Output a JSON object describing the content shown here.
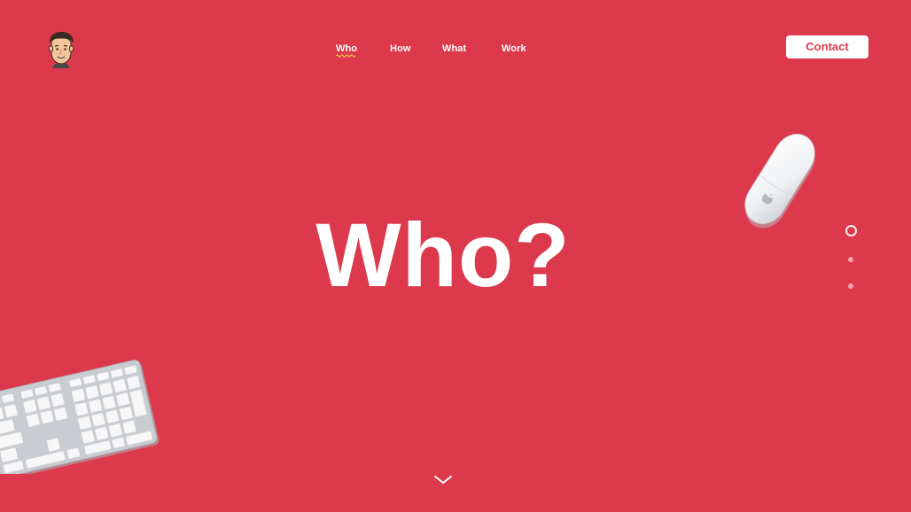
{
  "header": {
    "avatar_icon": "cartoon-face-avatar",
    "nav": [
      {
        "label": "Who",
        "active": true
      },
      {
        "label": "How",
        "active": false
      },
      {
        "label": "What",
        "active": false
      },
      {
        "label": "Work",
        "active": false
      }
    ],
    "contact_label": "Contact"
  },
  "hero": {
    "title": "Who?"
  },
  "pager": {
    "count": 3,
    "active_index": 0
  },
  "colors": {
    "background": "#dc3a4c",
    "text": "#ffffff",
    "underline_accent": "#f5c84c"
  },
  "icons": {
    "scroll": "chevron-down-icon",
    "mouse": "magic-mouse-illustration",
    "keyboard": "keyboard-illustration"
  }
}
